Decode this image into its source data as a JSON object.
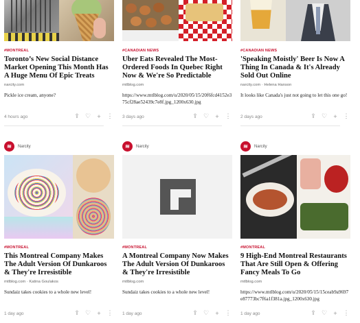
{
  "articles": [
    {
      "tag": "#MONTREAL",
      "title": "Toronto’s New Social Distance Market Opening This Month Has A Huge Menu Of Epic Treats",
      "source": "narcity.com",
      "description": "Pickle ice cream, anyone?",
      "age": "4 hours ago"
    },
    {
      "tag": "#CANADIAN NEWS",
      "title": "Uber Eats Revealed The Most-Ordered Foods In Quebec Right Now & We're So Predictable",
      "source": "mtlblog.com",
      "description": "https://www.mtlblog.com/u/2020/05/15/20f6fcd4152e375cf28ae52439c7e8f.jpg_1200x630.jpg",
      "age": "3 days ago"
    },
    {
      "tag": "#CANADIAN NEWS",
      "title": "'Speaking Moistly' Beer Is Now A Thing In Canada & It's Already Sold Out Online",
      "source": "narcity.com · Helena Hanson",
      "description": "It looks like Canada's just not going to let this one go!",
      "age": "2 days ago"
    },
    {
      "publisher": "Narcity",
      "tag": "#MONTREAL",
      "title": "This Montreal Company Makes The Adult Version Of Dunkaroos & They're Irresistible",
      "source": "mtlblog.com · Katina Goulakos",
      "description": "Sundaiz takes cookies to a whole new level!",
      "age": "1 day ago"
    },
    {
      "publisher": "Narcity",
      "tag": "#MONTREAL",
      "title": "A Montreal Company Now Makes The Adult Version Of Dunkaroos & They're Irresistible",
      "source": "mtlblog.com",
      "description": "Sundaiz takes cookies to a whole new level!",
      "age": "1 day ago"
    },
    {
      "publisher": "Narcity",
      "tag": "#MONTREAL",
      "title": "9 High-End Montreal Restaurants That Are Still Open & Offering Fancy Meals To Go",
      "source": "mtlblog.com",
      "description": "https://www.mtlblog.com/u/2020/05/15/15ceab9a9697e87773bc7f6a1f381a.jpg_1200x630.jpg",
      "age": "1 day ago"
    }
  ],
  "icons": {
    "share": "share-icon",
    "like": "heart-icon",
    "add": "plus-icon",
    "more": "more-icon"
  },
  "colors": {
    "accent": "#c8102e"
  }
}
